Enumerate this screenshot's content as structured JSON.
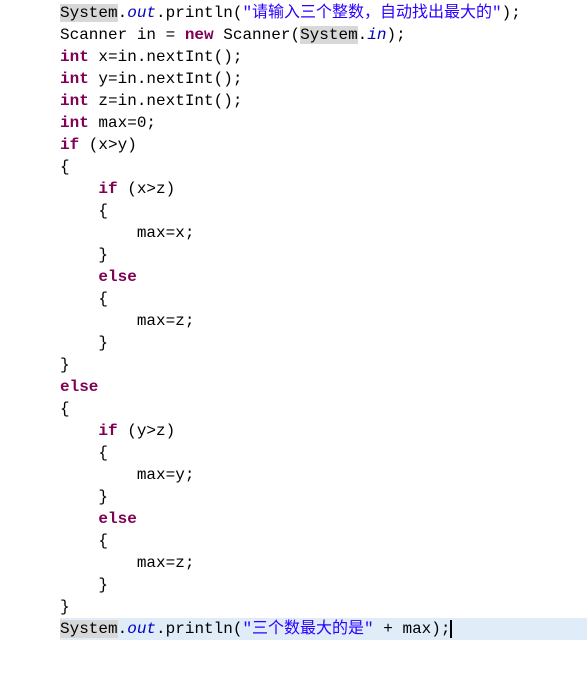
{
  "code": {
    "l01": {
      "sys": "System",
      "dot1": ".",
      "out": "out",
      "call": ".println(",
      "str": "\"请输入三个整数，自动找出最大的\"",
      "end": ");"
    },
    "l02": {
      "pre": "Scanner in = ",
      "kw_new": "new",
      "call": " Scanner(",
      "sys": "System",
      "dot": ".",
      "in": "in",
      "end": ");"
    },
    "l03": {
      "kw_int": "int",
      "rest": " x=in.nextInt();"
    },
    "l04": {
      "kw_int": "int",
      "rest": " y=in.nextInt();"
    },
    "l05": {
      "kw_int": "int",
      "rest": " z=in.nextInt();"
    },
    "l06": {
      "kw_int": "int",
      "rest": " max=0;"
    },
    "l07": {
      "kw_if": "if",
      "rest": " (x>y)"
    },
    "l08": "{",
    "l09": {
      "pad": "    ",
      "kw_if": "if",
      "rest": " (x>z)"
    },
    "l10": "    {",
    "l11": "        max=x;",
    "l12": "    }",
    "l13": {
      "pad": "    ",
      "kw_else": "else"
    },
    "l14": "    {",
    "l15": "        max=z;",
    "l16": "    }",
    "l17": "}",
    "l18": {
      "kw_else": "else"
    },
    "l19": "{",
    "l20": {
      "pad": "    ",
      "kw_if": "if",
      "rest": " (y>z)"
    },
    "l21": "    {",
    "l22": "        max=y;",
    "l23": "    }",
    "l24": {
      "pad": "    ",
      "kw_else": "else"
    },
    "l25": "    {",
    "l26": "        max=z;",
    "l27": "    }",
    "l28": "}",
    "l29": {
      "sys": "System",
      "dot1": ".",
      "out": "out",
      "call": ".println(",
      "str": "\"三个数最大的是\"",
      "plus": " + max);"
    }
  }
}
